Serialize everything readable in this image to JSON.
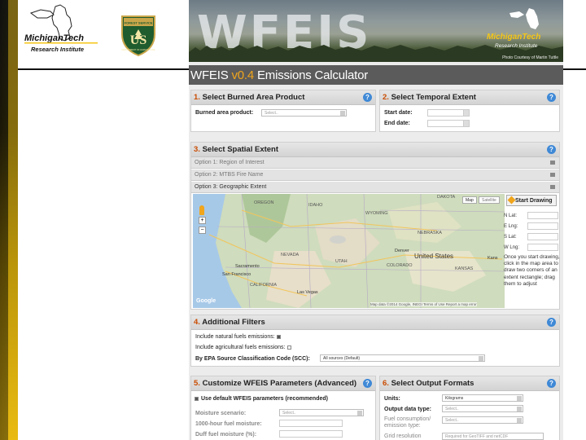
{
  "slide": {
    "mtu_logo": {
      "line1": "MichiganTech",
      "line2": "Research Institute"
    },
    "usfs_logo": {
      "top": "FOREST SERVICE",
      "letters": "US",
      "bottom": "DEPARTMENT OF AGRICULTURE",
      "icon": "usfs-shield-icon"
    }
  },
  "banner": {
    "title": "WFEIS",
    "credit": "Photo Courtesy of Martin Tuttle",
    "logo_line1": "MichiganTech",
    "logo_line2": "Research Institute"
  },
  "calc": {
    "prefix": "WFEIS ",
    "version": "v0.4",
    "suffix": " Emissions Calculator"
  },
  "s1": {
    "num": "1.",
    "title": "Select Burned Area Product",
    "field_label": "Burned area product:",
    "placeholder": "Select.."
  },
  "s2": {
    "num": "2.",
    "title": "Select Temporal Extent",
    "start_label": "Start date:",
    "end_label": "End date:"
  },
  "s3": {
    "num": "3.",
    "title": "Select Spatial Extent",
    "opt1": "Option 1: Region of Interest",
    "opt2": "Option 2: MTBS Fire Name",
    "opt3": "Option 3: Geographic Extent",
    "map_btn": "Map",
    "sat_btn": "Satellite",
    "places": {
      "oregon": "OREGON",
      "idaho": "IDAHO",
      "wyoming": "WYOMING",
      "nebraska": "NEBRASKA",
      "nevada": "NEVADA",
      "utah": "UTAH",
      "colorado": "COLORADO",
      "kansas": "KANSAS",
      "california": "CALIFORNIA",
      "dakota": "DAKOTA",
      "us": "United States",
      "denver": "Denver",
      "sacramento": "Sacramento",
      "sf": "San Francisco",
      "lv": "Las Vegas",
      "kansas_city": "Kans"
    },
    "google": "Google",
    "attribution": "Map data ©2014 Google, INEGI   Terms of Use   Report a map error",
    "draw": "Start Drawing",
    "n_lat": "N Lat:",
    "e_lng": "E Lng:",
    "s_lat": "S Lat:",
    "w_lng": "W Lng:",
    "hint": "Once you start drawing, click in the map area to draw two corners of an extent rectangle; drag them to adjust"
  },
  "s4": {
    "num": "4.",
    "title": "Additional Filters",
    "natural": "Include natural fuels emissions:",
    "agri": "Include agricultural fuels emissions:",
    "scc": "By EPA Source Classification Code (SCC):",
    "scc_value": "All sources (Default)"
  },
  "s5": {
    "num": "5.",
    "title": "Customize WFEIS Parameters (Advanced)",
    "default_params": "Use default WFEIS parameters (recommended)",
    "moisture": "Moisture scenario:",
    "moisture_ph": "Select..",
    "f1000": "1000-hour fuel moisture:",
    "duff": "Duff fuel moisture (%):"
  },
  "s6": {
    "num": "6.",
    "title": "Select Output Formats",
    "units": "Units:",
    "units_value": "Kilograms",
    "otype": "Output data type:",
    "otype_ph": "Select..",
    "fc1": "Fuel consumption/",
    "fc2": "emission type:",
    "fc_ph": "Select..",
    "grid": "Grid resolution",
    "grid_ph": "Required for GeoTIFF and netCDF"
  }
}
